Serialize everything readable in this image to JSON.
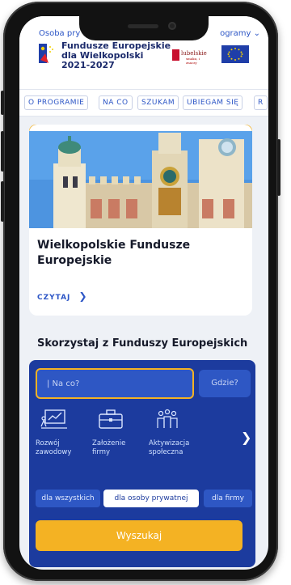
{
  "topbar": {
    "left": "Osoba pry",
    "right": "ogramy ⌄"
  },
  "header": {
    "logo_line1": "Fundusze Europejskie",
    "logo_line2": "dla Wielkopolski",
    "logo_line3": "2021-2027",
    "region_logo": "lubelskie",
    "region_sub": "smaku, i znaczy"
  },
  "nav": {
    "items": [
      "O PROGRAMIE",
      "NA CO",
      "SZUKAM",
      "UBIEGAM SIĘ",
      "R"
    ]
  },
  "card": {
    "title": "Wielkopolskie Fundusze Europejskie",
    "read_label": "CZYTAJ",
    "accent_color": "#f4b223"
  },
  "section": {
    "title": "Skorzystaj z Funduszy Europejskich"
  },
  "search": {
    "placeholder": "| Na co?",
    "where_label": "Gdzie?",
    "categories": [
      {
        "label": "Rozwój zawodowy",
        "icon": "chart-board-icon"
      },
      {
        "label": "Założenie firmy",
        "icon": "briefcase-icon"
      },
      {
        "label": "Aktywizacja społeczna",
        "icon": "people-group-icon"
      }
    ],
    "chips": [
      "dla wszystkich",
      "dla osoby prywatnej",
      "dla firmy"
    ],
    "selected_chip": "dla osoby prywatnej",
    "submit_label": "Wyszukaj"
  },
  "colors": {
    "brand_blue": "#1c3b9e",
    "accent_yellow": "#f4b223",
    "link_blue": "#2d56c6"
  }
}
